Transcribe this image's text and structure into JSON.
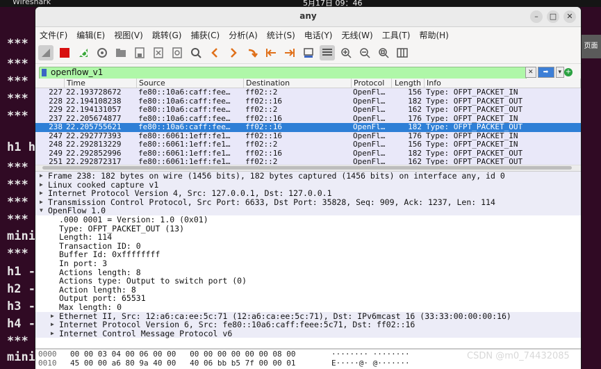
{
  "desktop": {
    "app_name": "Wireshark",
    "clock": "5月17日 09：46",
    "terminal_lines": [
      "***",
      "***",
      "***",
      "***",
      "***",
      "h1 h",
      "***",
      "***",
      "***",
      "***",
      "mini",
      "***",
      "h1 -",
      "h2 -",
      "h3 -",
      "h4 -",
      "***",
      "mini"
    ],
    "right_tab": "页面",
    "watermark": "CSDN @m0_74432085"
  },
  "window": {
    "title": "any",
    "btn_min": "–",
    "btn_max": "□",
    "btn_close": "✕"
  },
  "menu": [
    "文件(F)",
    "编辑(E)",
    "视图(V)",
    "跳转(G)",
    "捕获(C)",
    "分析(A)",
    "统计(S)",
    "电话(Y)",
    "无线(W)",
    "工具(T)",
    "帮助(H)"
  ],
  "filter": {
    "value": "openflow_v1",
    "clear": "✕",
    "apply": "➡",
    "dropdown": "▾",
    "add": "+"
  },
  "columns": [
    "",
    "Time",
    "Source",
    "Destination",
    "Protocol",
    "Length",
    "Info"
  ],
  "packets": [
    [
      "227",
      "22.193728672",
      "fe80::10a6:caff:fee…",
      "ff02::2",
      "OpenFl…",
      "156",
      "Type: OFPT_PACKET_IN"
    ],
    [
      "228",
      "22.194108238",
      "fe80::10a6:caff:fee…",
      "ff02::16",
      "OpenFl…",
      "182",
      "Type: OFPT_PACKET_OUT"
    ],
    [
      "229",
      "22.194131057",
      "fe80::10a6:caff:fee…",
      "ff02::2",
      "OpenFl…",
      "162",
      "Type: OFPT_PACKET_OUT"
    ],
    [
      "237",
      "22.205674877",
      "fe80::10a6:caff:fee…",
      "ff02::16",
      "OpenFl…",
      "176",
      "Type: OFPT_PACKET_IN"
    ],
    [
      "238",
      "22.205755621",
      "fe80::10a6:caff:fee…",
      "ff02::16",
      "OpenFl…",
      "182",
      "Type: OFPT_PACKET_OUT"
    ],
    [
      "247",
      "22.292777393",
      "fe80::6061:1eff:fe1…",
      "ff02::16",
      "OpenFl…",
      "176",
      "Type: OFPT_PACKET_IN"
    ],
    [
      "248",
      "22.292813229",
      "fe80::6061:1eff:fe1…",
      "ff02::2",
      "OpenFl…",
      "156",
      "Type: OFPT_PACKET_IN"
    ],
    [
      "249",
      "22.292852996",
      "fe80::6061:1eff:fe1…",
      "ff02::16",
      "OpenFl…",
      "182",
      "Type: OFPT_PACKET_OUT"
    ],
    [
      "251",
      "22.292872317",
      "fe80::6061:1eff:fe1…",
      "ff02::2",
      "OpenFl…",
      "162",
      "Type: OFPT_PACKET_OUT"
    ]
  ],
  "selected_packet": "238",
  "details": [
    {
      "t": "Frame 238: 182 bytes on wire (1456 bits), 182 bytes captured (1456 bits) on interface any, id 0",
      "lvl": 0,
      "arrow": "right"
    },
    {
      "t": "Linux cooked capture v1",
      "lvl": 0,
      "arrow": "right"
    },
    {
      "t": "Internet Protocol Version 4, Src: 127.0.0.1, Dst: 127.0.0.1",
      "lvl": 0,
      "arrow": "right"
    },
    {
      "t": "Transmission Control Protocol, Src Port: 6633, Dst Port: 35828, Seq: 909, Ack: 1237, Len: 114",
      "lvl": 0,
      "arrow": "right"
    },
    {
      "t": "OpenFlow 1.0",
      "lvl": 0,
      "arrow": "down"
    },
    {
      "t": ".000 0001 = Version: 1.0 (0x01)",
      "lvl": 1,
      "arrow": ""
    },
    {
      "t": "Type: OFPT_PACKET_OUT (13)",
      "lvl": 1,
      "arrow": ""
    },
    {
      "t": "Length: 114",
      "lvl": 1,
      "arrow": ""
    },
    {
      "t": "Transaction ID: 0",
      "lvl": 1,
      "arrow": ""
    },
    {
      "t": "Buffer Id: 0xffffffff",
      "lvl": 1,
      "arrow": ""
    },
    {
      "t": "In port: 3",
      "lvl": 1,
      "arrow": ""
    },
    {
      "t": "Actions length: 8",
      "lvl": 1,
      "arrow": ""
    },
    {
      "t": "Actions type: Output to switch port (0)",
      "lvl": 1,
      "arrow": ""
    },
    {
      "t": "Action length: 8",
      "lvl": 1,
      "arrow": ""
    },
    {
      "t": "Output port: 65531",
      "lvl": 1,
      "arrow": ""
    },
    {
      "t": "Max length: 0",
      "lvl": 1,
      "arrow": ""
    },
    {
      "t": "Ethernet II, Src: 12:a6:ca:ee:5c:71 (12:a6:ca:ee:5c:71), Dst: IPv6mcast_16 (33:33:00:00:00:16)",
      "lvl": 1,
      "arrow": "right"
    },
    {
      "t": "Internet Protocol Version 6, Src: fe80::10a6:caff:feee:5c71, Dst: ff02::16",
      "lvl": 1,
      "arrow": "right"
    },
    {
      "t": "Internet Control Message Protocol v6",
      "lvl": 1,
      "arrow": "right"
    }
  ],
  "bytes": [
    {
      "off": "0000",
      "hex": "00 00 03 04 00 06 00 00   00 00 00 00 00 00 08 00",
      "asc": "········ ········"
    },
    {
      "off": "0010",
      "hex": "45 00 00 a6 80 9a 40 00   40 06 bb b5 7f 00 00 01",
      "asc": "E·····@· @·······"
    }
  ],
  "colors": {
    "filter_bg": "#aff7a8",
    "row_bg": "#e9e8f9",
    "selected_row": "#2e7fd6"
  }
}
